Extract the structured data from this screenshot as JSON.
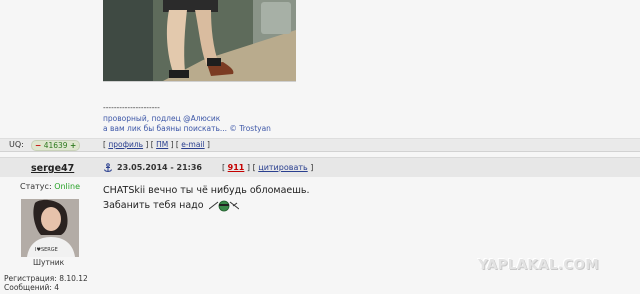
{
  "prev_post": {
    "signature_lines": [
      "---------------------",
      "проворный, подлец @Алюсик",
      "а вам лик бы баяны поискать... © Trostyan"
    ],
    "uq_label": "UQ:",
    "uq_minus": "−",
    "uq_value": "41639",
    "uq_plus": "+",
    "links": {
      "profile": "профиль",
      "pm": "ПМ",
      "email": "e-mail"
    }
  },
  "post": {
    "author": "serge47",
    "date": "23.05.2014 - 21:36",
    "number": "911",
    "quote_label": "цитировать",
    "status_label": "Статус: ",
    "status_value": "Online",
    "rank": "Шутник",
    "registration": "Регистрация: 8.10.12",
    "messages": "Сообщений: 4",
    "lines": [
      "CHATSkii вечно ты чё нибудь обломаешь.",
      "Забанить тебя надо"
    ]
  },
  "watermark": "YAPLAKAL.COM",
  "colors": {
    "link": "#2a3f8f",
    "online": "#2aa32a",
    "post_number": "#c40000",
    "header_bg": "#e7e7e7"
  }
}
